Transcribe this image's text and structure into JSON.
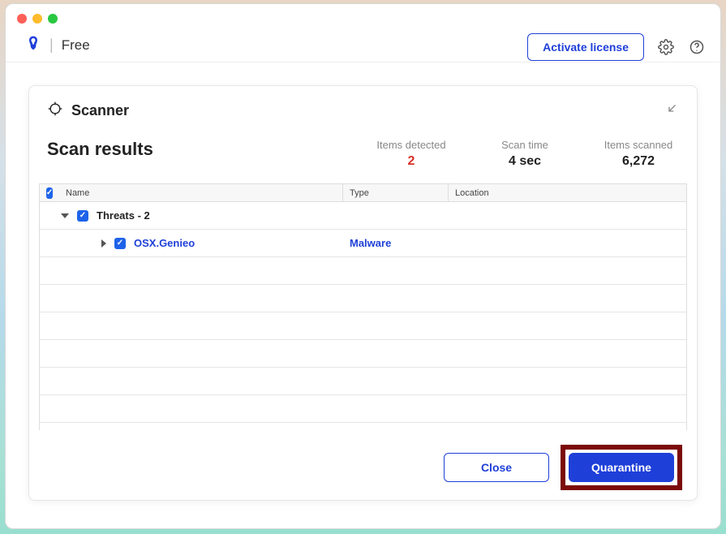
{
  "brand": {
    "tier": "Free"
  },
  "titlebar": {
    "activate_label": "Activate license"
  },
  "modal": {
    "title": "Scanner",
    "results_title": "Scan results",
    "stats": {
      "detected_label": "Items detected",
      "detected_value": "2",
      "time_label": "Scan time",
      "time_value": "4 sec",
      "scanned_label": "Items scanned",
      "scanned_value": "6,272"
    },
    "columns": {
      "name": "Name",
      "type": "Type",
      "location": "Location"
    },
    "group": {
      "label": "Threats - 2"
    },
    "rows": [
      {
        "name": "OSX.Genieo",
        "type": "Malware",
        "location": ""
      }
    ],
    "footer": {
      "close_label": "Close",
      "quarantine_label": "Quarantine"
    }
  }
}
